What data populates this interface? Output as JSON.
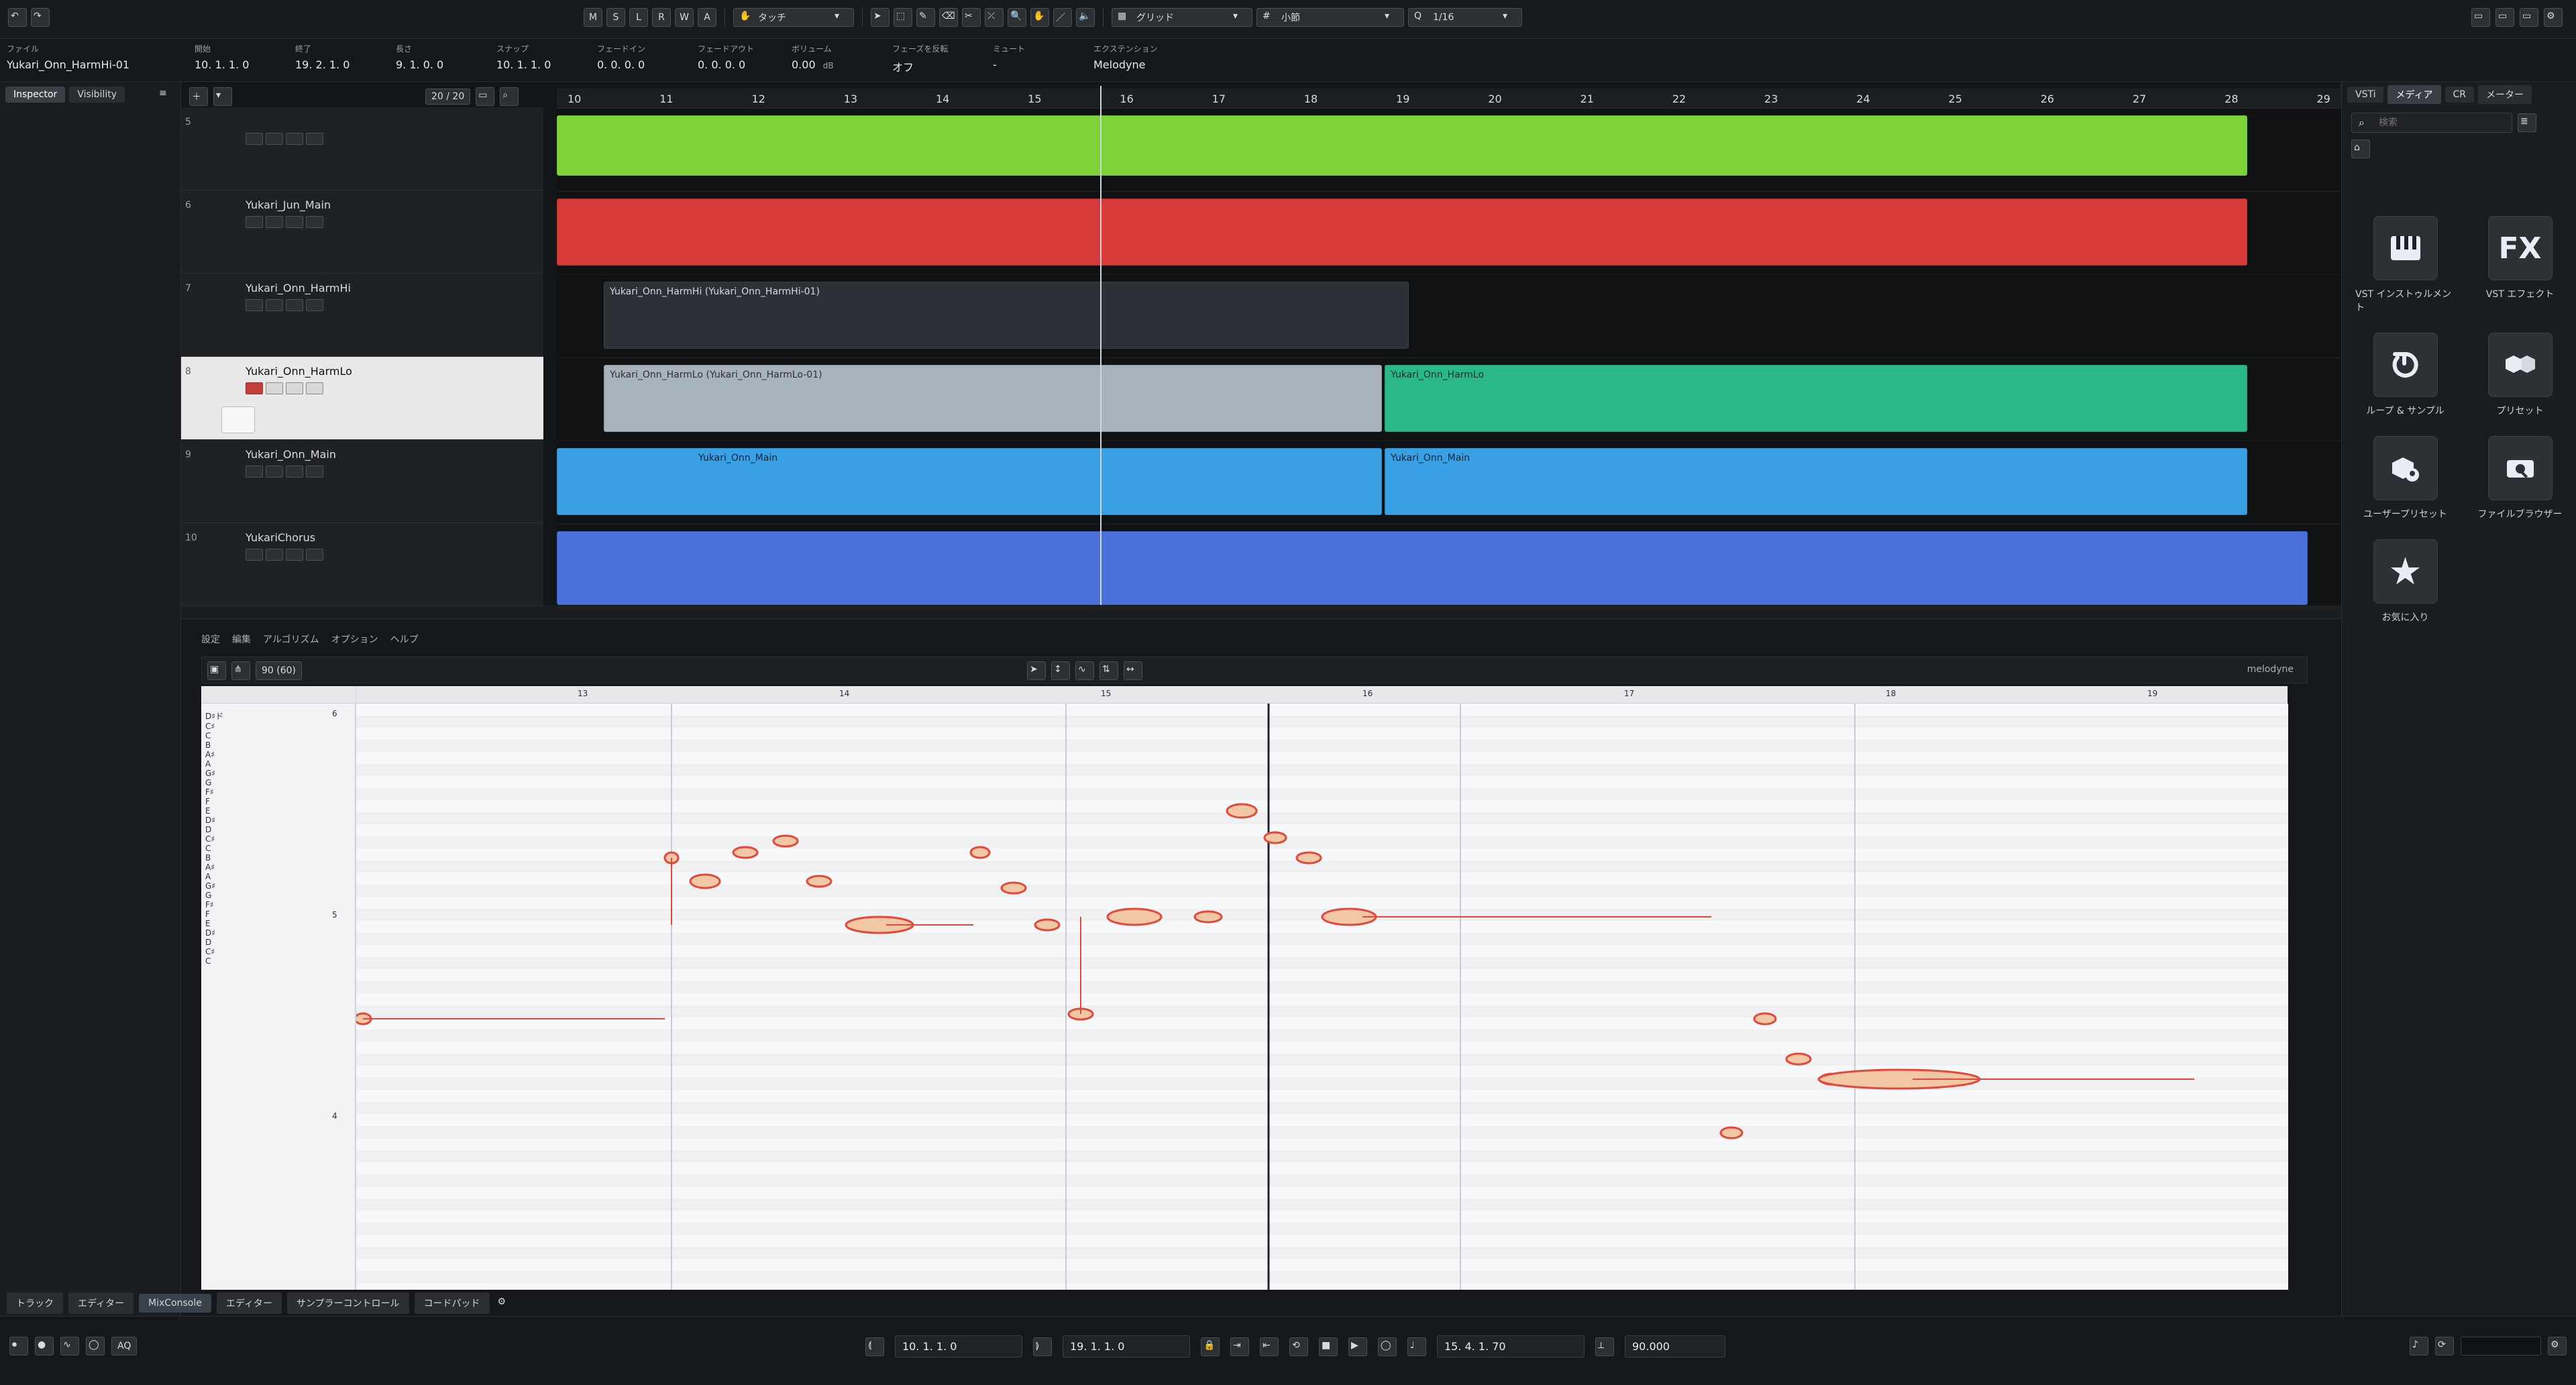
{
  "app": {
    "project_name": "Yukari_Onn_HarmHi-01"
  },
  "toolbar": {
    "buttons_msl": [
      "M",
      "S",
      "L",
      "R",
      "W",
      "A"
    ],
    "touch_mode": "タッチ",
    "grid_label": "グリッド",
    "snap_label": "小節",
    "quantize": "1/16"
  },
  "transport_info": {
    "file_label": "ファイル",
    "file_name": "Yukari_Onn_HarmHi-01",
    "start_label": "開始",
    "start_value": "10. 1. 1.  0",
    "end_label": "終了",
    "end_value": "19. 2. 1.  0",
    "length_label": "長さ",
    "length_value": "9. 1. 0.  0",
    "snap_label": "スナップ",
    "snap_value": "10. 1. 1.  0",
    "fadein_label": "フェードイン",
    "fadein_value": "0. 0. 0.  0",
    "fadeout_label": "フェードアウト",
    "fadeout_value": "0. 0. 0.  0",
    "volume_label": "ボリューム",
    "volume_value": "0.00",
    "volume_unit": "dB",
    "phase_label": "フェーズを反転",
    "phase_value": "オフ",
    "mute_label": "ミュート",
    "mute_value": "-",
    "ext_label": "エクステンション",
    "ext_value": "Melodyne"
  },
  "left": {
    "tabs": [
      "Inspector",
      "Visibility"
    ]
  },
  "project": {
    "ruler_marks": [
      "10",
      "11",
      "12",
      "13",
      "14",
      "15",
      "16",
      "17",
      "18",
      "19",
      "20",
      "21",
      "22",
      "23",
      "24",
      "25",
      "26",
      "27",
      "28",
      "29"
    ],
    "tracks": [
      {
        "num": "5",
        "name": ""
      },
      {
        "num": "6",
        "name": "Yukari_Jun_Main"
      },
      {
        "num": "7",
        "name": "Yukari_Onn_HarmHi"
      },
      {
        "num": "8",
        "name": "Yukari_Onn_HarmLo"
      },
      {
        "num": "9",
        "name": "Yukari_Onn_Main"
      },
      {
        "num": "10",
        "name": "YukariChorus"
      }
    ],
    "clips": [
      {
        "lane": 2,
        "label": "Yukari_Onn_HarmHi (Yukari_Onn_HarmHi-01)"
      },
      {
        "lane": 3,
        "label": "Yukari_Onn_HarmLo (Yukari_Onn_HarmLo-01)"
      },
      {
        "lane": 3,
        "label": "Yukari_Onn_HarmLo"
      },
      {
        "lane": 4,
        "label": "Yukari_Onn_Main"
      },
      {
        "lane": 4,
        "label": "Yukari_Onn_Main"
      }
    ],
    "track_count": "20 / 20"
  },
  "right": {
    "tabs": [
      "VSTi",
      "メディア",
      "CR",
      "メーター"
    ],
    "search_placeholder": "検索",
    "items": [
      {
        "label": "VST インストゥルメント",
        "icon": "piano-icon"
      },
      {
        "label": "VST エフェクト",
        "icon": "fx-icon"
      },
      {
        "label": "ループ & サンプル",
        "icon": "loop-icon"
      },
      {
        "label": "プリセット",
        "icon": "hexagons-icon"
      },
      {
        "label": "ユーザープリセット",
        "icon": "user-preset-icon"
      },
      {
        "label": "ファイルブラウザー",
        "icon": "file-browser-icon"
      },
      {
        "label": "お気に入り",
        "icon": "star-icon"
      }
    ]
  },
  "editor": {
    "menu": [
      "設定",
      "編集",
      "アルゴリズム",
      "オプション",
      "ヘルプ"
    ],
    "zoom_value": "90 (60)",
    "plugin_label": "melodyne",
    "bar_numbers": [
      "13",
      "14",
      "15",
      "16",
      "17",
      "18",
      "19"
    ],
    "pitch_labels": [
      "D♯ド",
      "C♯",
      "C",
      "B",
      "A♯",
      "A",
      "G♯",
      "G",
      "F♯",
      "F",
      "E",
      "D♯",
      "D",
      "C♯",
      "C",
      "B",
      "A♯",
      "A",
      "G♯",
      "G",
      "F♯",
      "F",
      "E",
      "D♯",
      "D",
      "C♯",
      "C"
    ],
    "octave_markers": [
      "6",
      "5",
      "4"
    ]
  },
  "bottom_tabs": [
    "トラック",
    "エディター",
    "MixConsole",
    "エディター",
    "サンプラーコントロール",
    "コードパッド"
  ],
  "transport": {
    "left_locator": "10. 1. 1.  0",
    "right_locator": "19. 1. 1.  0",
    "position": "15. 4. 1. 70",
    "tempo": "90.000"
  },
  "colors": {
    "green_clip": "#7ed23a",
    "red_clip": "#d63a3a",
    "teal_clip": "#2bb889",
    "blue_clip": "#39a0e3",
    "violet_clip": "#4a70d9",
    "note_color": "#e4483a"
  }
}
